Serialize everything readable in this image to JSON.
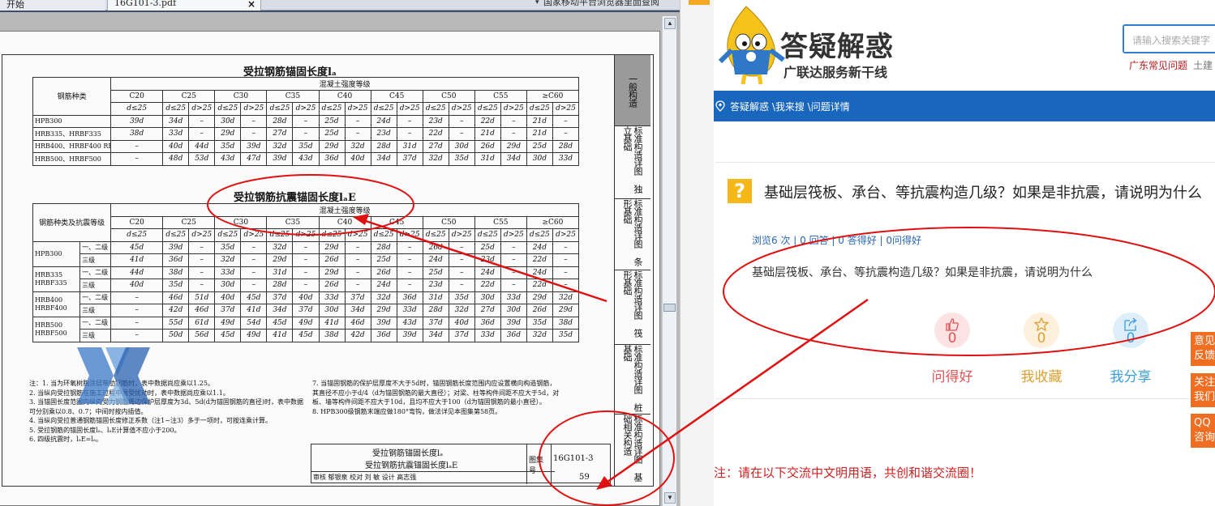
{
  "pdf_viewer": {
    "tabs": [
      {
        "label": "开始"
      },
      {
        "label": "16G101-3.pdf",
        "close": "×"
      }
    ],
    "tab_extra": "国家移动平台浏览器里面查阅",
    "scroll_up": "▲",
    "scroll_down": "▼"
  },
  "drawing": {
    "table1": {
      "title": "受拉钢筋锚固长度lₐ",
      "group_header": "混凝土强度等级",
      "row_header": "钢筋种类",
      "grades": [
        "C20",
        "C25",
        "C30",
        "C35",
        "C40",
        "C45",
        "C50",
        "C55",
        "≥C60"
      ],
      "d_le": "d≤25",
      "d_gt": "d>25",
      "rows": [
        {
          "name": "HPB300",
          "cells": [
            "39d",
            "34d",
            "–",
            "30d",
            "–",
            "28d",
            "–",
            "25d",
            "–",
            "24d",
            "–",
            "23d",
            "–",
            "22d",
            "–",
            "21d",
            "–"
          ]
        },
        {
          "name": "HRB335、HRBF335",
          "cells": [
            "38d",
            "33d",
            "–",
            "29d",
            "–",
            "27d",
            "–",
            "25d",
            "–",
            "23d",
            "–",
            "22d",
            "–",
            "21d",
            "–",
            "21d",
            "–"
          ]
        },
        {
          "name": "HRB400、HRBF400 RRB400",
          "cells": [
            "–",
            "40d",
            "44d",
            "35d",
            "39d",
            "32d",
            "35d",
            "29d",
            "32d",
            "28d",
            "31d",
            "27d",
            "30d",
            "26d",
            "29d",
            "25d",
            "28d"
          ]
        },
        {
          "name": "HRB500、HRBF500",
          "cells": [
            "–",
            "48d",
            "53d",
            "43d",
            "47d",
            "39d",
            "43d",
            "36d",
            "40d",
            "34d",
            "37d",
            "32d",
            "35d",
            "31d",
            "34d",
            "30d",
            "33d"
          ]
        }
      ]
    },
    "table2": {
      "title": "受拉钢筋抗震锚固长度lₐE",
      "group_header": "混凝土强度等级",
      "row_header": "钢筋种类及抗震等级",
      "grades": [
        "C20",
        "C25",
        "C30",
        "C35",
        "C40",
        "C45",
        "C50",
        "C55",
        "≥C60"
      ],
      "rows": [
        {
          "steel": "HPB300",
          "level": "一、二级",
          "cells": [
            "45d",
            "39d",
            "–",
            "35d",
            "–",
            "32d",
            "–",
            "29d",
            "–",
            "28d",
            "–",
            "26d",
            "–",
            "25d",
            "–",
            "24d",
            "–"
          ]
        },
        {
          "steel": "",
          "level": "三级",
          "cells": [
            "41d",
            "36d",
            "–",
            "32d",
            "–",
            "29d",
            "–",
            "26d",
            "–",
            "25d",
            "–",
            "24d",
            "–",
            "23d",
            "–",
            "22d",
            "–"
          ]
        },
        {
          "steel": "HRB335 HRBF335",
          "level": "一、二级",
          "cells": [
            "44d",
            "38d",
            "–",
            "33d",
            "–",
            "31d",
            "–",
            "29d",
            "–",
            "26d",
            "–",
            "25d",
            "–",
            "24d",
            "–",
            "24d",
            "–"
          ]
        },
        {
          "steel": "",
          "level": "三级",
          "cells": [
            "40d",
            "35d",
            "–",
            "30d",
            "–",
            "28d",
            "–",
            "26d",
            "–",
            "24d",
            "–",
            "23d",
            "–",
            "22d",
            "–",
            "22d",
            "–"
          ]
        },
        {
          "steel": "HRB400 HRBF400",
          "level": "一、二级",
          "cells": [
            "–",
            "46d",
            "51d",
            "40d",
            "45d",
            "37d",
            "40d",
            "33d",
            "37d",
            "32d",
            "36d",
            "31d",
            "35d",
            "30d",
            "33d",
            "29d",
            "32d"
          ]
        },
        {
          "steel": "",
          "level": "三级",
          "cells": [
            "–",
            "42d",
            "46d",
            "37d",
            "41d",
            "34d",
            "37d",
            "30d",
            "34d",
            "29d",
            "33d",
            "28d",
            "32d",
            "27d",
            "30d",
            "26d",
            "29d"
          ]
        },
        {
          "steel": "HRB500 HRBF500",
          "level": "一、二级",
          "cells": [
            "–",
            "55d",
            "61d",
            "49d",
            "54d",
            "45d",
            "49d",
            "41d",
            "46d",
            "39d",
            "43d",
            "37d",
            "40d",
            "36d",
            "39d",
            "35d",
            "38d"
          ]
        },
        {
          "steel": "",
          "level": "三级",
          "cells": [
            "–",
            "50d",
            "56d",
            "45d",
            "49d",
            "41d",
            "45d",
            "38d",
            "42d",
            "36d",
            "39d",
            "34d",
            "37d",
            "33d",
            "36d",
            "32d",
            "35d"
          ]
        }
      ]
    },
    "notes_left": [
      "注：1. 当为环氧树脂涂层带肋钢筋时，表中数据尚应乘以1.25。",
      "2. 当纵向受拉钢筋在施工过程中易受扰动时，表中数据尚应乘以1.1。",
      "3. 当锚固长度范围内纵向受力钢筋周边保护层厚度为3d、5d(d为锚固钢筋的直径)时，表中数据可分别乘以0.8、0.7；中间时按内插值。",
      "4. 当纵向受拉普通钢筋锚固长度修正系数（注1~注3）多于一项时，可按连乘计算。",
      "5. 受拉钢筋的锚固长度lₐ、lₐE计算值不应小于200。",
      "6. 四级抗震时，lₐE=lₐ。"
    ],
    "notes_right": [
      "7. 当锚固钢筋的保护层厚度不大于5d时，锚固钢筋长度范围内应设置横向构造钢筋，其直径不应小于d/4（d为锚固钢筋的最大直径）；对梁、柱等构件间距不应大于5d，对板、墙等构件间距不应大于10d，且均不应大于100（d为锚固钢筋的最小直径）。",
      "8. HPB300级钢筋末端应做180°弯钩，做法详见本图集第58页。"
    ],
    "title_block": {
      "title1": "受拉钢筋锚固长度lₐ",
      "title2": "受拉钢筋抗震锚固长度lₐE",
      "atlas_label": "图集号",
      "atlas_no": "16G101-3",
      "page_label": "页",
      "page_no": "59",
      "sign_row": "审核 郁银泉 校对 刘 敏 设计 高志强"
    },
    "side_index": [
      "一般构造",
      "标准构造详图 独立基础",
      "标准构造详图 条形基础",
      "标准构造详图 筏形基础",
      "标准构造详图 桩基础",
      "标准构造详图 基础相关构造"
    ]
  },
  "site": {
    "brand_title": "答疑解惑",
    "brand_sub": "广联达服务新干线",
    "search_placeholder": "请输入搜索关键字",
    "hot_link_1": "广东常见问题",
    "hot_link_2": "土建",
    "breadcrumb": "答疑解惑 \\我来搜 \\问题详情",
    "question_mark": "?",
    "question_title": "基础层筏板、承台、等抗震构造几级？如果是非抗震，请说明为什么",
    "stats": "浏览6 次 | 0 回答 | 0 答得好 | 0问得好",
    "question_body": "基础层筏板、承台、等抗震构造几级？如果是非抗震，请说明为什么",
    "actions": [
      {
        "count": "0",
        "label": "问得好",
        "icon": "thumbs-up-icon",
        "color": "#e05555",
        "bg": "#fde3e3"
      },
      {
        "count": "0",
        "label": "我收藏",
        "icon": "star-icon",
        "color": "#e0a030",
        "bg": "#fdf0dc"
      },
      {
        "count": "0",
        "label": "我分享",
        "icon": "share-icon",
        "color": "#3a9ee0",
        "bg": "#ddeefa"
      }
    ],
    "float_buttons": [
      "意见反馈",
      "关注我们",
      "QQ咨询"
    ],
    "notice": "注：请在以下交流中文明用语，共创和谐交流圈！"
  },
  "annotation_color": "#e01010"
}
